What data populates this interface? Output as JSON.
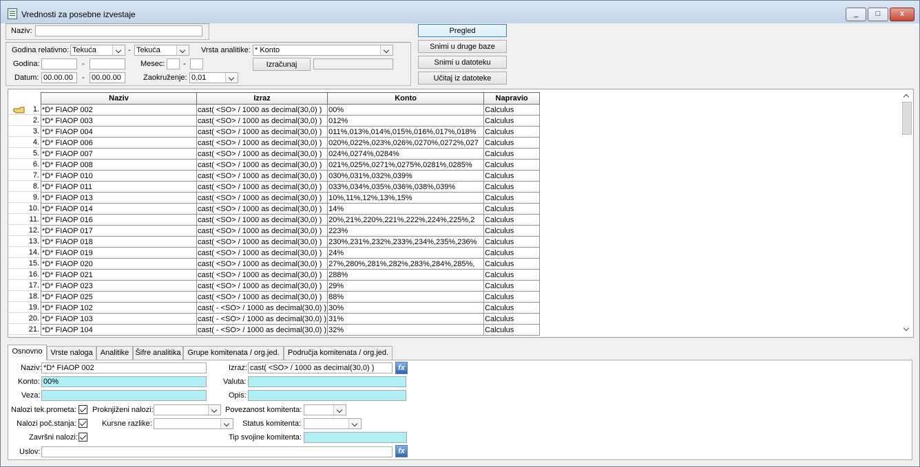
{
  "window": {
    "title": "Vrednosti za posebne izvestaje",
    "controls": [
      "_",
      "□",
      "x"
    ]
  },
  "filters": {
    "naziv_label": "Naziv:",
    "naziv_value": "",
    "godina_relativno_label": "Godina relativno:",
    "godina_rel_from": "Tekuća",
    "godina_rel_to": "Tekuća",
    "dash": "-",
    "vrsta_analitike_label": "Vrsta analitike:",
    "vrsta_analitike_value": "* Konto",
    "godina_label": "Godina:",
    "godina_from": "",
    "godina_to": "",
    "mesec_label": "Mesec:",
    "mesec_from": "",
    "mesec_to": "",
    "izracunaj_label": "Izračunaj",
    "izracunaj_result": "",
    "datum_label": "Datum:",
    "datum_from": "00.00.00",
    "datum_to": "00.00.00",
    "zaokruzenje_label": "Zaokruženje:",
    "zaokruzenje_value": "0,01"
  },
  "actions": {
    "pregled": "Pregled",
    "snimi_druge_baze": "Snimi u druge baze",
    "snimi_datoteku": "Snimi u datoteku",
    "ucitaj_datoteke": "Učitaj iz datoteke"
  },
  "grid": {
    "columns": [
      "Naziv",
      "Izraz",
      "Konto",
      "Napravio"
    ],
    "rows": [
      {
        "n": "1.",
        "naziv": "*D* FIAOP 002",
        "izraz": "cast( <SO> / 1000 as decimal(30,0) )",
        "konto": "00%",
        "napravio": "Calculus"
      },
      {
        "n": "2.",
        "naziv": "*D* FIAOP 003",
        "izraz": "cast( <SO> / 1000 as decimal(30,0) )",
        "konto": "012%",
        "napravio": "Calculus"
      },
      {
        "n": "3.",
        "naziv": "*D* FIAOP 004",
        "izraz": "cast( <SO> / 1000 as decimal(30,0) )",
        "konto": "011%,013%,014%,015%,016%,017%,018%",
        "napravio": "Calculus"
      },
      {
        "n": "4.",
        "naziv": "*D* FIAOP 006",
        "izraz": "cast( <SO> / 1000 as decimal(30,0) )",
        "konto": "020%,022%,023%,026%,0270%,0272%,027",
        "napravio": "Calculus"
      },
      {
        "n": "5.",
        "naziv": "*D* FIAOP 007",
        "izraz": "cast( <SO> / 1000 as decimal(30,0) )",
        "konto": "024%,0274%,0284%",
        "napravio": "Calculus"
      },
      {
        "n": "6.",
        "naziv": "*D* FIAOP 008",
        "izraz": "cast( <SO> / 1000 as decimal(30,0) )",
        "konto": "021%,025%,0271%,0275%,0281%,0285%",
        "napravio": "Calculus"
      },
      {
        "n": "7.",
        "naziv": "*D* FIAOP 010",
        "izraz": "cast( <SO> / 1000 as decimal(30,0) )",
        "konto": "030%,031%,032%,039%",
        "napravio": "Calculus"
      },
      {
        "n": "8.",
        "naziv": "*D* FIAOP 011",
        "izraz": "cast( <SO> / 1000 as decimal(30,0) )",
        "konto": "033%,034%,035%,036%,038%,039%",
        "napravio": "Calculus"
      },
      {
        "n": "9.",
        "naziv": "*D* FIAOP 013",
        "izraz": "cast( <SO> / 1000 as decimal(30,0) )",
        "konto": "10%,11%,12%,13%,15%",
        "napravio": "Calculus"
      },
      {
        "n": "10.",
        "naziv": "*D* FIAOP 014",
        "izraz": "cast( <SO> / 1000 as decimal(30,0) )",
        "konto": "14%",
        "napravio": "Calculus"
      },
      {
        "n": "11.",
        "naziv": "*D* FIAOP 016",
        "izraz": "cast( <SO> / 1000 as decimal(30,0) )",
        "konto": "20%,21%,220%,221%,222%,224%,225%,2",
        "napravio": "Calculus"
      },
      {
        "n": "12.",
        "naziv": "*D* FIAOP 017",
        "izraz": "cast( <SO> / 1000 as decimal(30,0) )",
        "konto": "223%",
        "napravio": "Calculus"
      },
      {
        "n": "13.",
        "naziv": "*D* FIAOP 018",
        "izraz": "cast( <SO> / 1000 as decimal(30,0) )",
        "konto": "230%,231%,232%,233%,234%,235%,236%",
        "napravio": "Calculus"
      },
      {
        "n": "14.",
        "naziv": "*D* FIAOP 019",
        "izraz": "cast( <SO> / 1000 as decimal(30,0) )",
        "konto": "24%",
        "napravio": "Calculus"
      },
      {
        "n": "15.",
        "naziv": "*D* FIAOP 020",
        "izraz": "cast( <SO> / 1000 as decimal(30,0) )",
        "konto": "27%,280%,281%,282%,283%,284%,285%,",
        "napravio": "Calculus"
      },
      {
        "n": "16.",
        "naziv": "*D* FIAOP 021",
        "izraz": "cast( <SO> / 1000 as decimal(30,0) )",
        "konto": "288%",
        "napravio": "Calculus"
      },
      {
        "n": "17.",
        "naziv": "*D* FIAOP 023",
        "izraz": "cast( <SO> / 1000 as decimal(30,0) )",
        "konto": "29%",
        "napravio": "Calculus"
      },
      {
        "n": "18.",
        "naziv": "*D* FIAOP 025",
        "izraz": "cast( <SO> / 1000 as decimal(30,0) )",
        "konto": "88%",
        "napravio": "Calculus"
      },
      {
        "n": "19.",
        "naziv": "*D* FIAOP 102",
        "izraz": "cast( - <SO> / 1000 as decimal(30,0) )",
        "konto": "30%",
        "napravio": "Calculus"
      },
      {
        "n": "20.",
        "naziv": "*D* FIAOP 103",
        "izraz": "cast( - <SO> / 1000 as decimal(30,0) )",
        "konto": "31%",
        "napravio": "Calculus"
      },
      {
        "n": "21.",
        "naziv": "*D* FIAOP 104",
        "izraz": "cast( - <SO> / 1000 as decimal(30,0) )",
        "konto": "32%",
        "napravio": "Calculus"
      }
    ]
  },
  "tabs": [
    "Osnovno",
    "Vrste naloga",
    "Analitike",
    "Šifre analitika",
    "Grupe komitenata / org.jed.",
    "Područja komitenata / org.jed."
  ],
  "detail": {
    "naziv_label": "Naziv:",
    "naziv_value": "*D* FIAOP 002",
    "izraz_label": "Izraz:",
    "izraz_value": "cast( <SO> / 1000 as decimal(30,0) )",
    "konto_label": "Konto:",
    "konto_value": "00%",
    "valuta_label": "Valuta:",
    "valuta_value": "",
    "veza_label": "Veza:",
    "veza_value": "",
    "opis_label": "Opis:",
    "opis_value": "",
    "nalozi_tek_label": "Nalozi tek.prometa:",
    "nalozi_poc_label": "Nalozi poč.stanja:",
    "zavrsni_label": "Završni nalozi:",
    "proknjizeni_label": "Proknjiženi nalozi:",
    "kursne_label": "Kursne razlike:",
    "povezanost_label": "Povezanost komitenta:",
    "status_label": "Status komitenta:",
    "tip_svojine_label": "Tip svojine komitenta:",
    "uslov_label": "Uslov:",
    "uslov_value": "",
    "fx": "fx"
  }
}
